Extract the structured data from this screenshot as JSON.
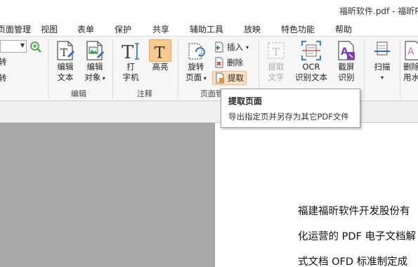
{
  "window": {
    "title": "福昕软件.pdf - 福昕P"
  },
  "menu": [
    "页面管理",
    "视图",
    "表单",
    "保护",
    "共享",
    "辅助工具",
    "放映",
    "特色功能",
    "帮助"
  ],
  "left_panel": {
    "zoom_value": "",
    "cut_label_1": "转",
    "cut_label_2": "转"
  },
  "groups": {
    "edit": {
      "label": "编辑",
      "edit_text": [
        "编辑",
        "文本"
      ],
      "edit_object": [
        "编辑",
        "对象"
      ]
    },
    "comment": {
      "label": "注释",
      "typewriter": [
        "打",
        "字机"
      ],
      "highlight": "高亮"
    },
    "page": {
      "label": "页面管",
      "rotate": [
        "旋转",
        "页面"
      ],
      "insert": "插入",
      "delete": "删除",
      "extract": "提取"
    },
    "convert": {
      "extract_text": [
        "提取",
        "文字"
      ],
      "ocr": [
        "OCR",
        "识别文本"
      ],
      "screenshot": [
        "截屏",
        "识别"
      ]
    },
    "scan": {
      "scan": "扫描"
    },
    "more": {
      "label_1": "删除",
      "label_2": "用水"
    }
  },
  "tooltip": {
    "title": "提取页面",
    "description": "导出指定页并另存为其它PDF文件"
  },
  "document": {
    "lines": [
      "福建福昕软件开发股份有",
      "化运营的 PDF 电子文档解",
      "式文档 OFD 标准制定成"
    ]
  },
  "colors": {
    "highlight_orange": "#f7c98e",
    "accent_blue": "#2b6cc4",
    "pdf_purple": "#7a3fb0"
  }
}
